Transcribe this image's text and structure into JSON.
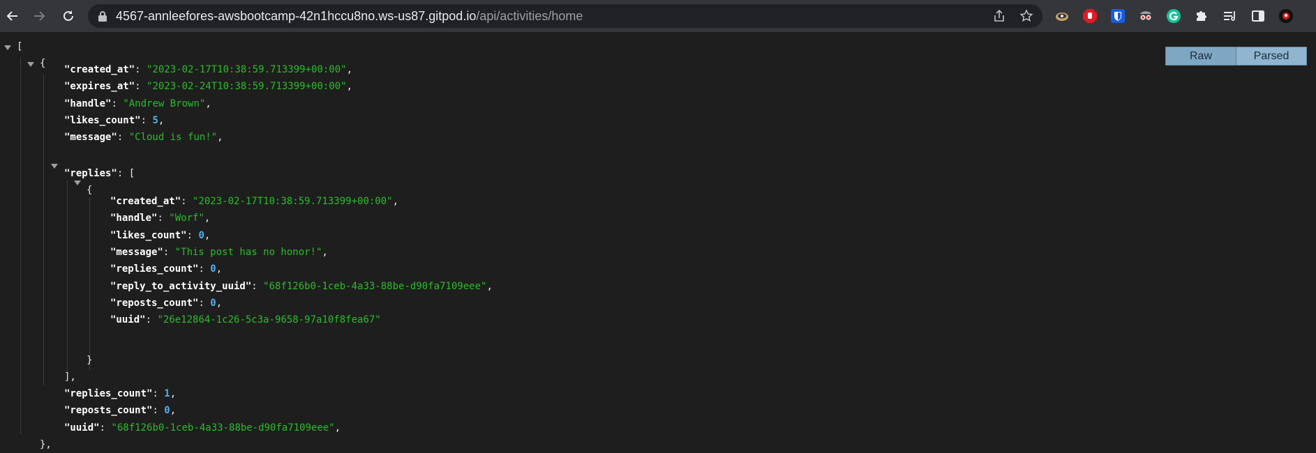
{
  "browser": {
    "url_host": "4567-annleefores-awsbootcamp-42n1hccu8no.ws-us87.gitpod.io",
    "url_path": "/api/activities/home",
    "nav_icons": [
      "back-arrow-icon",
      "forward-arrow-icon",
      "reload-icon"
    ],
    "omnibox_icons": [
      "lock-icon",
      "share-icon",
      "bookmark-star-icon"
    ],
    "extension_icons": [
      "cloud-sync-icon",
      "adblock-hand-icon",
      "bitwarden-shield-icon",
      "spy-glasses-icon",
      "grammarly-icon",
      "puzzle-extensions-icon",
      "reading-list-icon",
      "side-panel-icon",
      "profile-avatar-icon"
    ]
  },
  "viewer": {
    "raw_label": "Raw",
    "parsed_label": "Parsed",
    "brackets": {
      "root_open": "[",
      "item_open": "{",
      "item_close": "},",
      "replies_close": "],",
      "reply_open": "{",
      "reply_close": "}"
    },
    "activity": {
      "fields": [
        {
          "key": "\"created_at\"",
          "value": "\"2023-02-17T10:38:59.713399+00:00\"",
          "type": "str"
        },
        {
          "key": "\"expires_at\"",
          "value": "\"2023-02-24T10:38:59.713399+00:00\"",
          "type": "str"
        },
        {
          "key": "\"handle\"",
          "value": "\"Andrew Brown\"",
          "type": "str"
        },
        {
          "key": "\"likes_count\"",
          "value": "5",
          "type": "num"
        },
        {
          "key": "\"message\"",
          "value": "\"Cloud is fun!\"",
          "type": "str"
        }
      ],
      "replies_key": "\"replies\"",
      "replies_open": "[",
      "tail_fields": [
        {
          "key": "\"replies_count\"",
          "value": "1",
          "type": "num"
        },
        {
          "key": "\"reposts_count\"",
          "value": "0",
          "type": "num"
        },
        {
          "key": "\"uuid\"",
          "value": "\"68f126b0-1ceb-4a33-88be-d90fa7109eee\"",
          "type": "str"
        }
      ]
    },
    "reply": {
      "fields": [
        {
          "key": "\"created_at\"",
          "value": "\"2023-02-17T10:38:59.713399+00:00\"",
          "type": "str"
        },
        {
          "key": "\"handle\"",
          "value": "\"Worf\"",
          "type": "str"
        },
        {
          "key": "\"likes_count\"",
          "value": "0",
          "type": "num"
        },
        {
          "key": "\"message\"",
          "value": "\"This post has no honor!\"",
          "type": "str"
        },
        {
          "key": "\"replies_count\"",
          "value": "0",
          "type": "num"
        },
        {
          "key": "\"reply_to_activity_uuid\"",
          "value": "\"68f126b0-1ceb-4a33-88be-d90fa7109eee\"",
          "type": "str"
        },
        {
          "key": "\"reposts_count\"",
          "value": "0",
          "type": "num"
        },
        {
          "key": "\"uuid\"",
          "value": "\"26e12864-1c26-5c3a-9658-97a10f8fea67\"",
          "type": "str"
        }
      ]
    }
  }
}
